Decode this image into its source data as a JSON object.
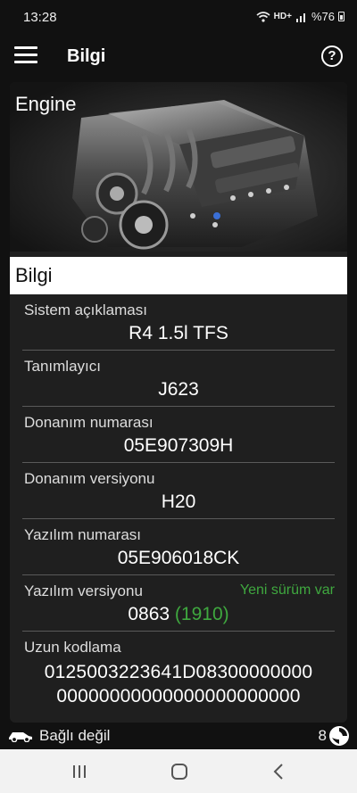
{
  "status_bar": {
    "time": "13:28",
    "signal_text": "HD+",
    "battery": "%76"
  },
  "app_bar": {
    "title": "Bilgi",
    "help_glyph": "?"
  },
  "hero": {
    "title": "Engine"
  },
  "section": {
    "header": "Bilgi"
  },
  "info": {
    "system_desc": {
      "label": "Sistem açıklaması",
      "value": "R4 1.5l TFS"
    },
    "identifier": {
      "label": "Tanımlayıcı",
      "value": "J623"
    },
    "hw_number": {
      "label": "Donanım numarası",
      "value": "05E907309H"
    },
    "hw_version": {
      "label": "Donanım versiyonu",
      "value": "H20"
    },
    "sw_number": {
      "label": "Yazılım numarası",
      "value": "05E906018CK"
    },
    "sw_version": {
      "label": "Yazılım versiyonu",
      "value": "0863",
      "new_value": "(1910)",
      "update_notice": "Yeni sürüm var"
    },
    "long_coding": {
      "label": "Uzun kodlama",
      "line1": "0125003223641D08300000000",
      "line2": "00000000000000000000000"
    }
  },
  "bottom_status": {
    "connection": "Bağlı değil",
    "count": "8"
  },
  "colors": {
    "accent_green": "#3fa83f",
    "background": "#111111",
    "card": "#1f1f1f"
  },
  "icons": [
    "menu-icon",
    "help-icon",
    "car-icon",
    "globe-icon",
    "nav-recent-icon",
    "nav-home-icon",
    "nav-back-icon"
  ]
}
